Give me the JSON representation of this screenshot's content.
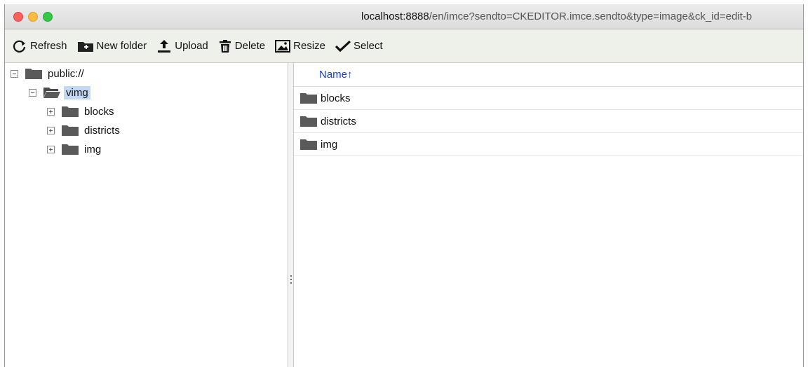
{
  "browser": {
    "url_host": "localhost:8888",
    "url_path": "/en/imce?sendto=CKEDITOR.imce.sendto&type=image&ck_id=edit-b"
  },
  "toolbar": {
    "refresh_label": "Refresh",
    "new_folder_label": "New folder",
    "upload_label": "Upload",
    "delete_label": "Delete",
    "resize_label": "Resize",
    "select_label": "Select"
  },
  "tree": {
    "root": "public://",
    "current": "vimg",
    "children": [
      "blocks",
      "districts",
      "img"
    ]
  },
  "file_list": {
    "column_name": "Name",
    "sort_indicator": "↑",
    "rows": [
      "blocks",
      "districts",
      "img"
    ]
  },
  "colors": {
    "accent": "#1a3fc4",
    "selection": "#c2d8f2",
    "toolbar_bg": "#eef1ea"
  }
}
